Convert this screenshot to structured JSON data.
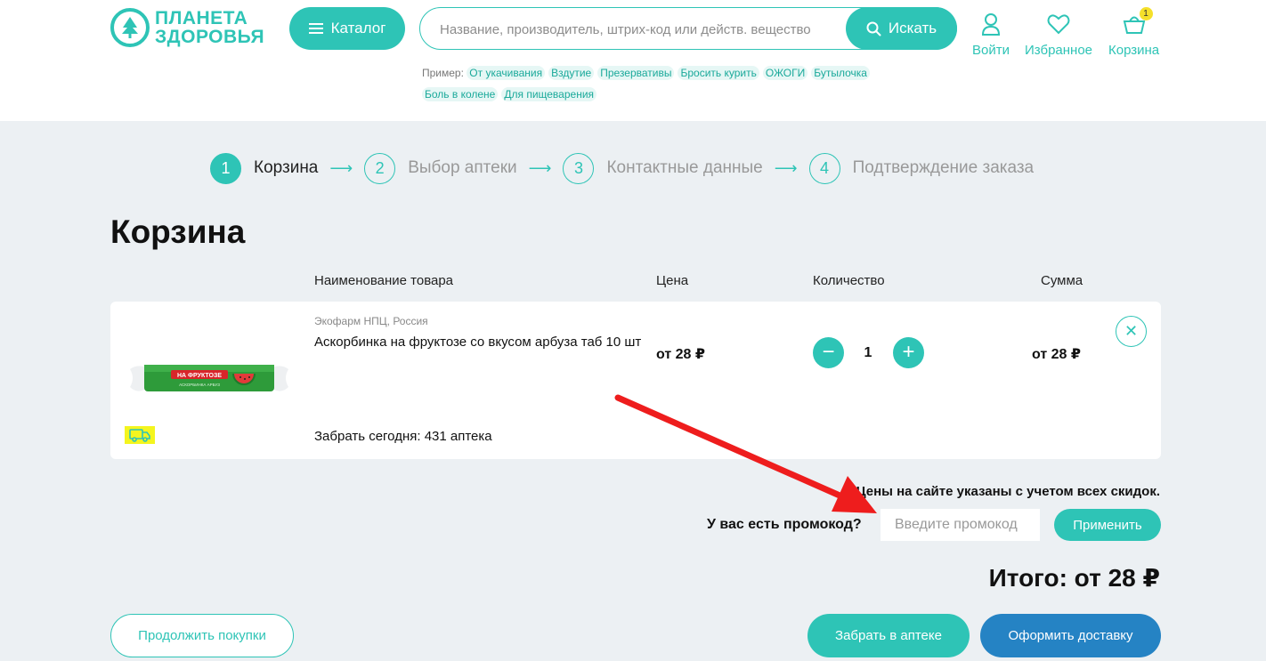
{
  "header": {
    "logo_line1": "ПЛАНЕТА",
    "logo_line2": "ЗДОРОВЬЯ",
    "catalog_label": "Каталог",
    "search_placeholder": "Название, производитель, штрих-код или действ. вещество",
    "search_button": "Искать",
    "examples_label": "Пример:",
    "examples": [
      "От укачивания",
      "Вздутие",
      "Презервативы",
      "Бросить курить",
      "ОЖОГИ",
      "Бутылочка",
      "Боль в колене",
      "Для пищеварения"
    ],
    "login_label": "Войти",
    "favorites_label": "Избранное",
    "cart_label": "Корзина",
    "cart_count": "1"
  },
  "steps": [
    {
      "num": "1",
      "label": "Корзина",
      "active": true
    },
    {
      "num": "2",
      "label": "Выбор аптеки",
      "active": false
    },
    {
      "num": "3",
      "label": "Контактные данные",
      "active": false
    },
    {
      "num": "4",
      "label": "Подтверждение заказа",
      "active": false
    }
  ],
  "page_title": "Корзина",
  "columns": {
    "name": "Наименование товара",
    "price": "Цена",
    "qty": "Количество",
    "sum": "Сумма"
  },
  "item": {
    "maker": "Экофарм НПЦ, Россия",
    "name": "Аскорбинка на фруктозе со вкусом арбуза таб 10 шт",
    "package_text": "НА ФРУКТОЗЕ",
    "package_subtext": "АСКОРБИНКА АРБУЗ",
    "price": "от 28 ₽",
    "qty": "1",
    "sum": "от 28 ₽",
    "pickup": "Забрать сегодня: 431 аптека"
  },
  "discount_note": "Цены на сайте указаны с учетом всех скидок.",
  "promo": {
    "question": "У вас есть промокод?",
    "placeholder": "Введите промокод",
    "apply": "Применить"
  },
  "total": "Итого: от 28 ₽",
  "buttons": {
    "continue": "Продолжить покупки",
    "pickup": "Забрать в аптеке",
    "delivery": "Оформить доставку"
  },
  "colors": {
    "accent": "#2ec4b6",
    "delivery_button": "#2583c4",
    "annotation_arrow": "#ee1d1d",
    "highlight": "#f4f51e"
  }
}
